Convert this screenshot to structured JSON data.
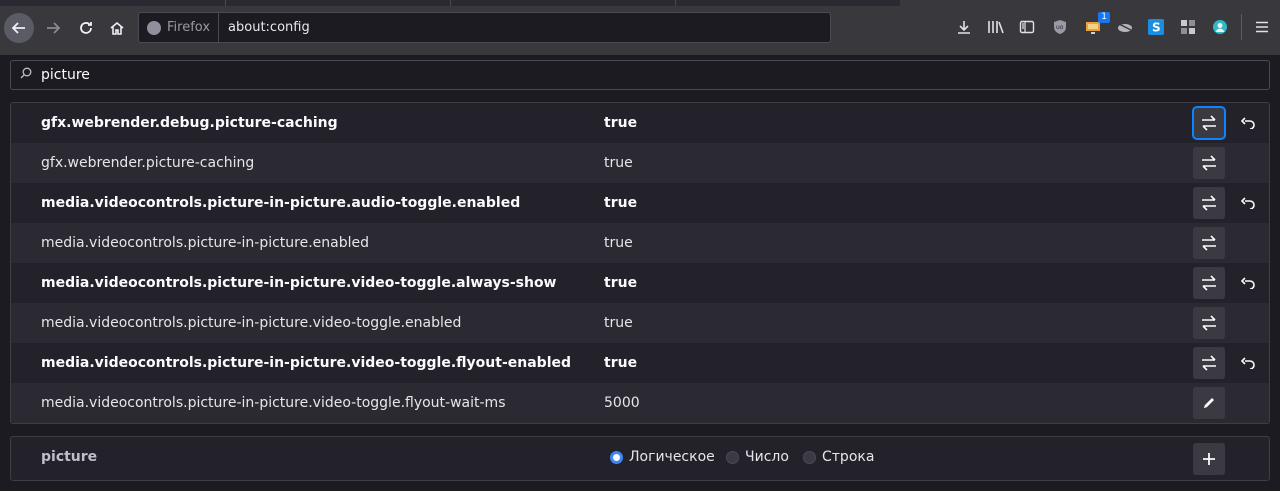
{
  "browser": {
    "identity_label": "Firefox",
    "url": "about:config",
    "badge_count": "1"
  },
  "search": {
    "value": "picture"
  },
  "prefs": [
    {
      "name": "gfx.webrender.debug.picture-caching",
      "value": "true",
      "modified": true,
      "action": "toggle"
    },
    {
      "name": "gfx.webrender.picture-caching",
      "value": "true",
      "modified": false,
      "action": "toggle"
    },
    {
      "name": "media.videocontrols.picture-in-picture.audio-toggle.enabled",
      "value": "true",
      "modified": true,
      "action": "toggle"
    },
    {
      "name": "media.videocontrols.picture-in-picture.enabled",
      "value": "true",
      "modified": false,
      "action": "toggle"
    },
    {
      "name": "media.videocontrols.picture-in-picture.video-toggle.always-show",
      "value": "true",
      "modified": true,
      "action": "toggle"
    },
    {
      "name": "media.videocontrols.picture-in-picture.video-toggle.enabled",
      "value": "true",
      "modified": false,
      "action": "toggle"
    },
    {
      "name": "media.videocontrols.picture-in-picture.video-toggle.flyout-enabled",
      "value": "true",
      "modified": true,
      "action": "toggle"
    },
    {
      "name": "media.videocontrols.picture-in-picture.video-toggle.flyout-wait-ms",
      "value": "5000",
      "modified": false,
      "action": "edit"
    }
  ],
  "add_row": {
    "name": "picture",
    "types": [
      {
        "label": "Логическое",
        "selected": true
      },
      {
        "label": "Число",
        "selected": false
      },
      {
        "label": "Строка",
        "selected": false
      }
    ]
  },
  "colors": {
    "accent": "#0a84ff",
    "radio_selected": "#3f86f5",
    "background": "#1c1b22"
  }
}
